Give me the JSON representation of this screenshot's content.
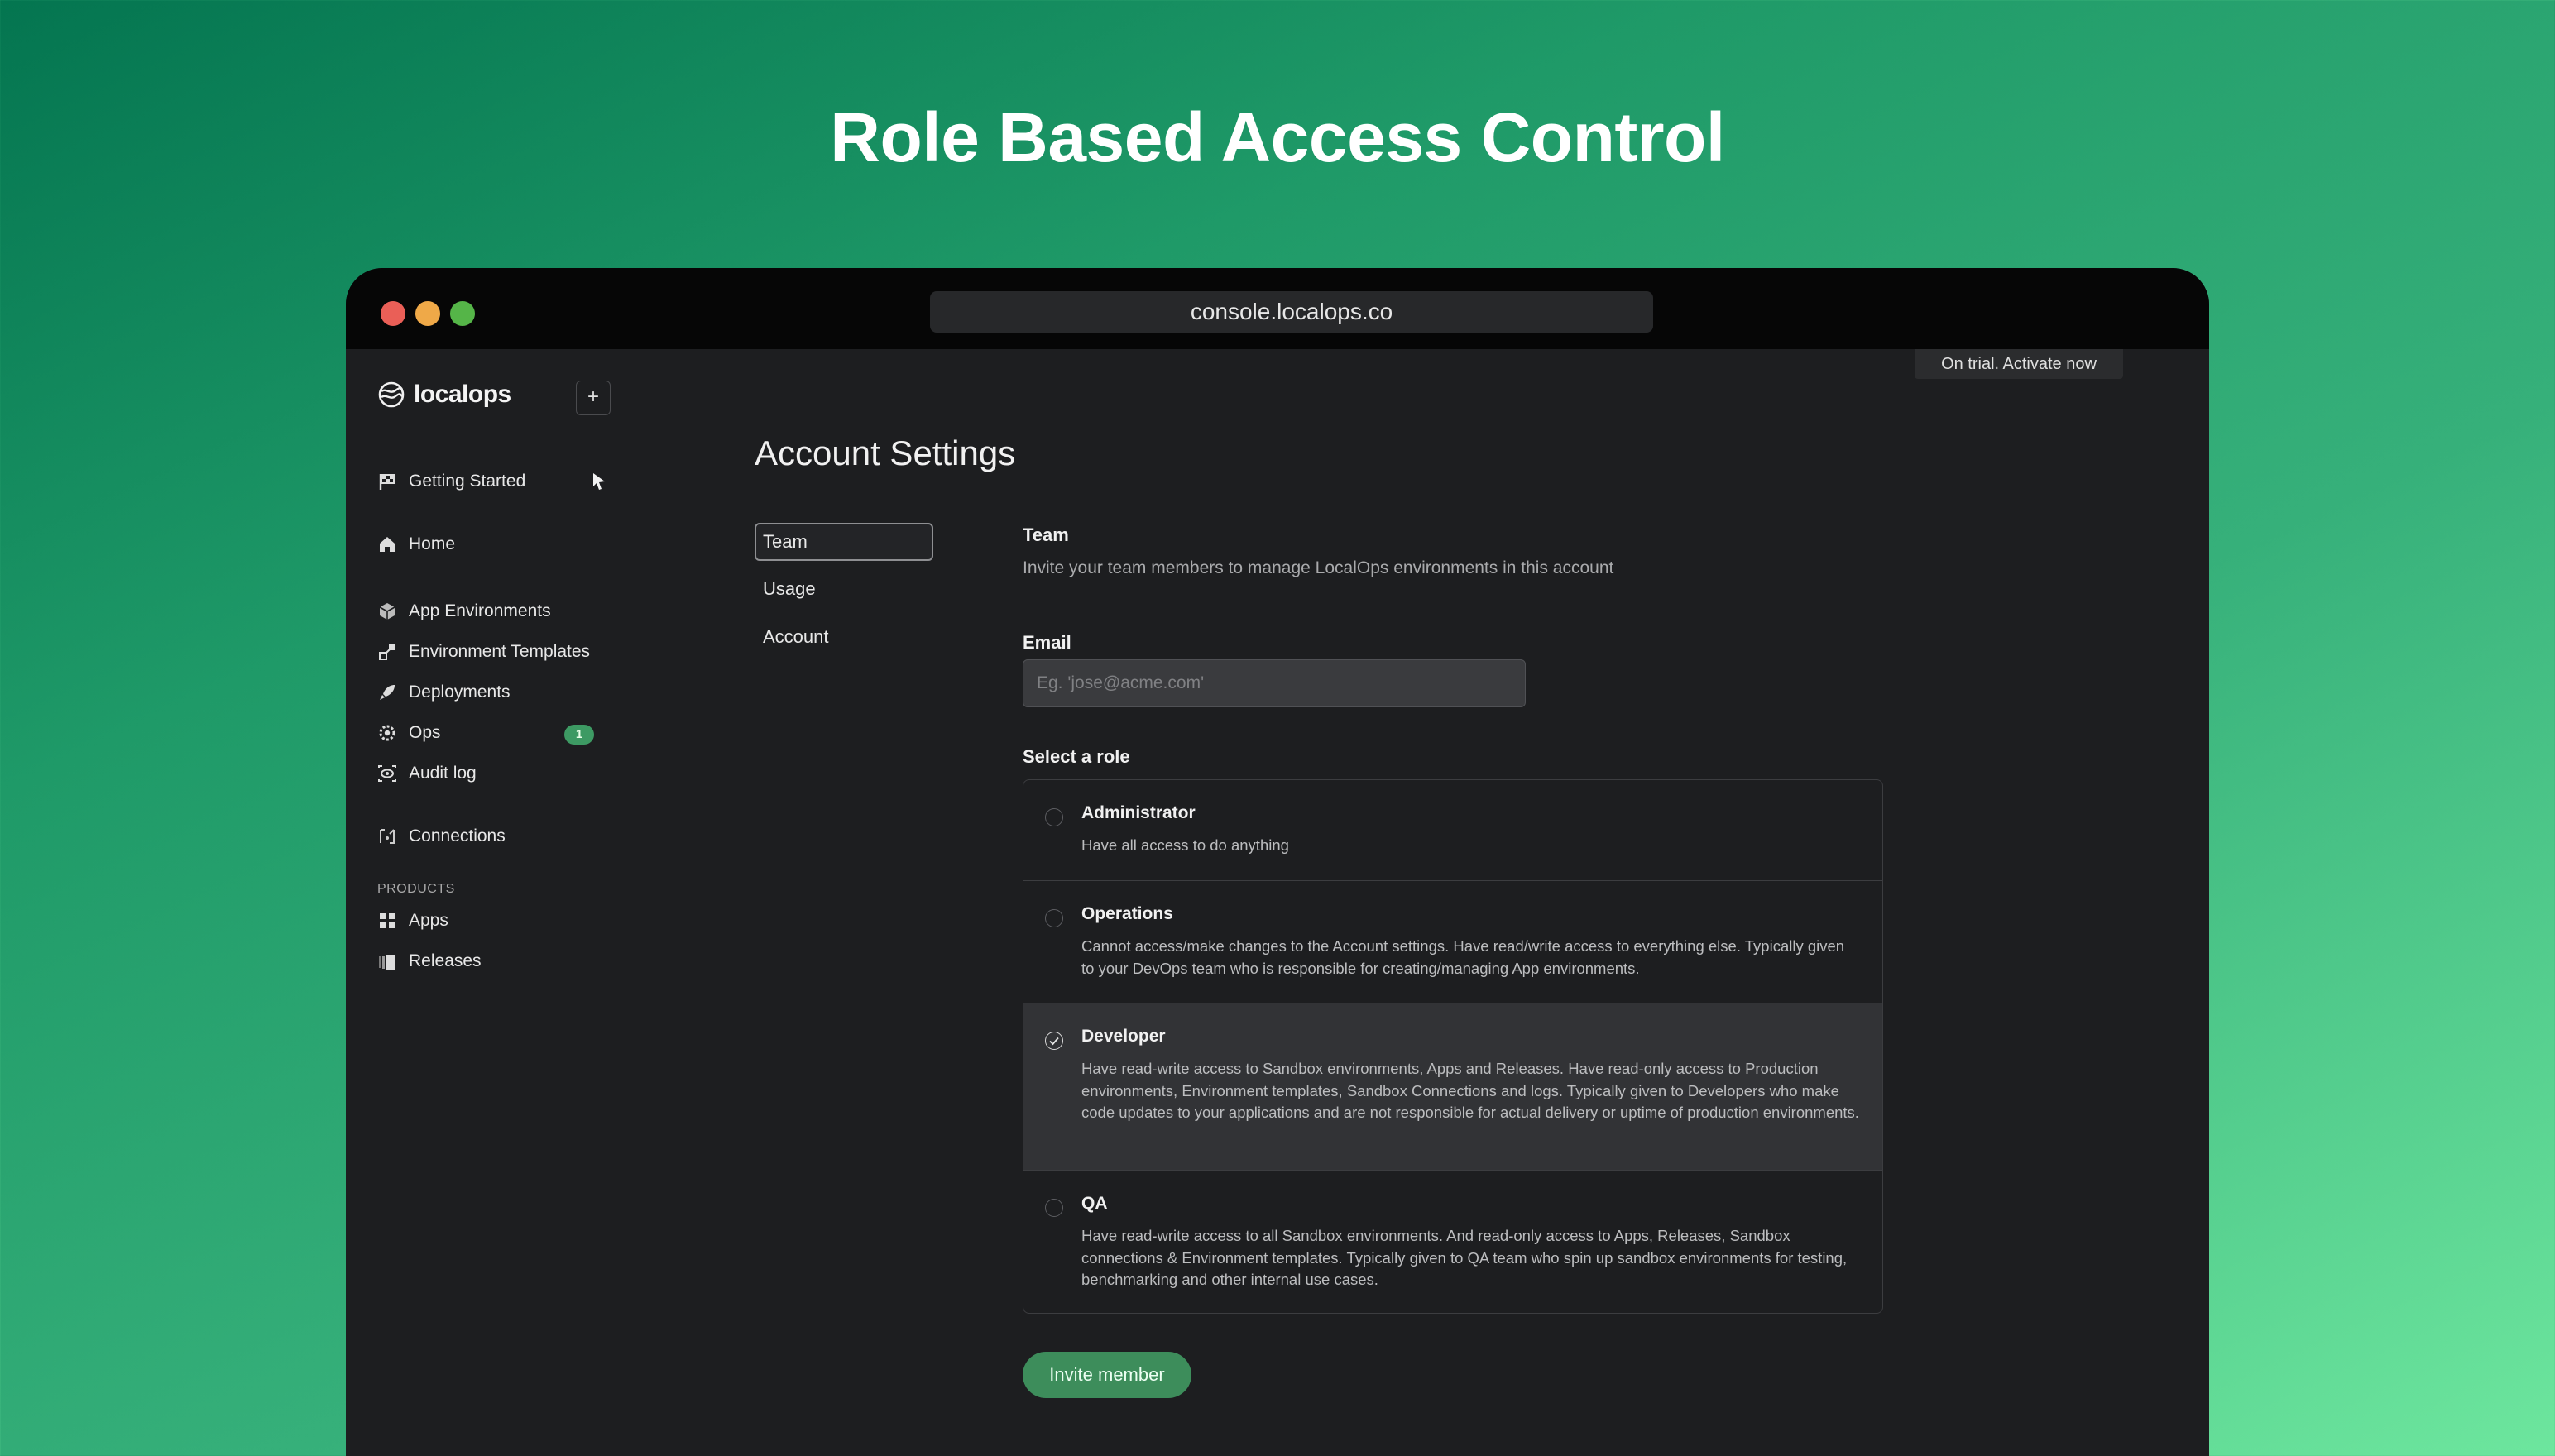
{
  "hero": {
    "title": "Role Based Access Control"
  },
  "browser": {
    "url": "console.localops.co"
  },
  "trial_banner": "On trial.  Activate now",
  "sidebar": {
    "logo_text": "localops",
    "add_label": "+",
    "items": [
      {
        "label": "Getting Started",
        "icon": "flag-checkered-icon"
      },
      {
        "label": "Home",
        "icon": "home-icon"
      },
      {
        "label": "App Environments",
        "icon": "cube-icon"
      },
      {
        "label": "Environment Templates",
        "icon": "template-icon"
      },
      {
        "label": "Deployments",
        "icon": "rocket-icon"
      },
      {
        "label": "Ops",
        "icon": "gear-icon",
        "badge": "1"
      },
      {
        "label": "Audit log",
        "icon": "eye-icon"
      },
      {
        "label": "Connections",
        "icon": "connections-icon"
      }
    ],
    "products_label": "PRODUCTS",
    "products": [
      {
        "label": "Apps",
        "icon": "grid-icon"
      },
      {
        "label": "Releases",
        "icon": "releases-icon"
      }
    ]
  },
  "main": {
    "title": "Account Settings",
    "subnav": [
      "Team",
      "Usage",
      "Account"
    ],
    "active_subnav": "Team",
    "section_title": "Team",
    "section_desc": "Invite your team members to manage LocalOps environments in this account",
    "email_label": "Email",
    "email_placeholder": "Eg. 'jose@acme.com'",
    "email_value": "",
    "role_label": "Select a role",
    "roles": [
      {
        "name": "Administrator",
        "desc": "Have all access to do anything",
        "selected": false
      },
      {
        "name": "Operations",
        "desc": "Cannot access/make changes to the Account settings. Have read/write access to everything else. Typically given to your DevOps team who is responsible for creating/managing App environments.",
        "selected": false
      },
      {
        "name": "Developer",
        "desc": "Have read-write access to Sandbox environments, Apps and Releases. Have read-only access to Production environments, Environment templates, Sandbox Connections and logs. Typically given to Developers who make code updates to your applications and are not responsible for actual delivery or uptime of production environments.",
        "selected": true
      },
      {
        "name": "QA",
        "desc": "Have read-write access to all Sandbox environments. And read-only access to Apps, Releases, Sandbox connections & Environment templates. Typically given to QA team who spin up sandbox environments for testing, benchmarking and other internal use cases.",
        "selected": false
      }
    ],
    "invite_label": "Invite member"
  },
  "colors": {
    "accent": "#3d8d5b",
    "window_bg": "#1d1e20",
    "titlebar_bg": "#060606"
  }
}
